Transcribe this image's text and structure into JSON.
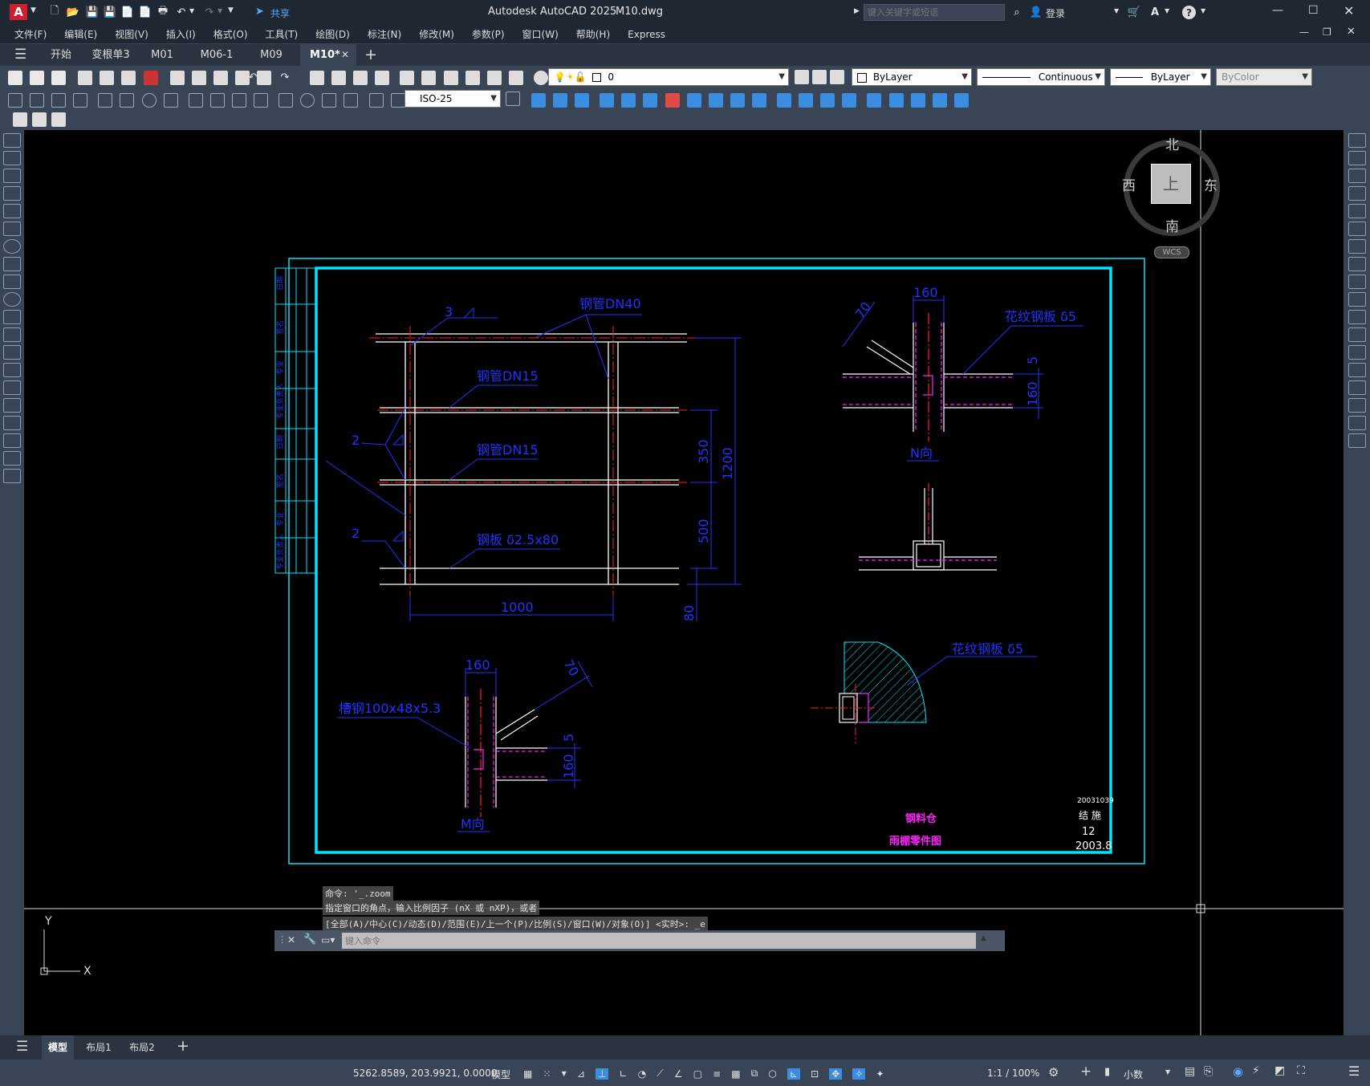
{
  "app": {
    "logo": "A",
    "window_title": "Autodesk AutoCAD 2025",
    "file_name": "M10.dwg",
    "share_label": "共享",
    "search_placeholder": "键入关键字或短语",
    "login_label": "登录"
  },
  "menu": [
    "文件(F)",
    "编辑(E)",
    "视图(V)",
    "插入(I)",
    "格式(O)",
    "工具(T)",
    "绘图(D)",
    "标注(N)",
    "修改(M)",
    "参数(P)",
    "窗口(W)",
    "帮助(H)",
    "Express"
  ],
  "doc_tabs": [
    "开始",
    "变根单3",
    "M01",
    "M06-1",
    "M09",
    "M10*"
  ],
  "toolbar": {
    "layer_value": "0",
    "color_value": "ByLayer",
    "linetype_value": "Continuous",
    "lineweight_value": "ByLayer",
    "plotstyle_value": "ByColor",
    "dimstyle_value": "ISO-25"
  },
  "viewcube": {
    "north": "北",
    "south": "南",
    "east": "东",
    "west": "西",
    "face": "上",
    "wcs": "WCS"
  },
  "drawing": {
    "labels": {
      "pipe_dn40": "钢管DN40",
      "pipe_dn15_a": "钢管DN15",
      "pipe_dn15_b": "钢管DN15",
      "plate": "钢板 δ2.5x80",
      "weld3": "3",
      "weld2a": "2",
      "weld2b": "2",
      "dim_1000": "1000",
      "dim_1200": "1200",
      "dim_350": "350",
      "dim_500": "500",
      "dim_80": "80",
      "n_160": "160",
      "n_70": "70",
      "n_5": "5",
      "n_160v": "160",
      "checker_plate_1": "花纹钢板 δ5",
      "n_view": "N向",
      "m_160": "160",
      "m_70": "70",
      "m_5": "5",
      "m_160v": "160",
      "channel": "槽钢100x48x5.3",
      "m_view": "M向",
      "checker_plate_2": "花纹钢板 δ5"
    },
    "titleblock": {
      "project": "钢料仓",
      "drawing_name": "雨棚零件图",
      "number": "20031039",
      "discipline": "结 施",
      "sheet": "12",
      "date": "2003.8"
    },
    "left_strip": [
      "日期",
      "签名",
      "专业",
      "专业负责人",
      "日期",
      "签名",
      "专业",
      "专业负责人"
    ],
    "ucs_x": "X",
    "ucs_y": "Y"
  },
  "command": {
    "line1": "命令: '_.zoom",
    "line2": "指定窗口的角点，输入比例因子 (nX 或 nXP)，或者",
    "line3": "[全部(A)/中心(C)/动态(D)/范围(E)/上一个(P)/比例(S)/窗口(W)/对象(O)] <实时>: _e",
    "placeholder": "键入命令"
  },
  "layouts": [
    "模型",
    "布局1",
    "布局2"
  ],
  "status": {
    "coords": "5262.8589, 203.9921, 0.0000",
    "space": "模型",
    "scale": "1:1 / 100%",
    "units": "小数"
  },
  "colors": {
    "cyan": "#00e5ff",
    "blue": "#2233ff",
    "magenta": "#ff22ff",
    "red": "#ff2020",
    "panel": "#394454"
  }
}
